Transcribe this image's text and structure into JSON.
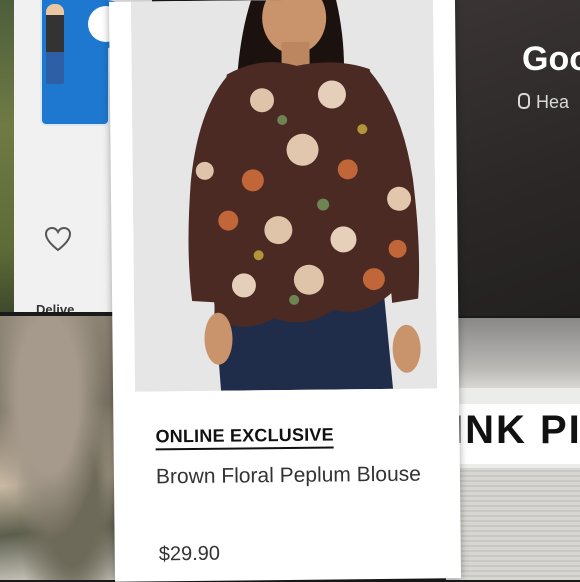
{
  "collage": {
    "tile_top_left": {
      "icon": "heart-outline-icon",
      "footer_text": "Delive"
    },
    "tile_top_right": {
      "title": "Goo",
      "subtitle": "Hea"
    },
    "tile_bottom_right": {
      "print_text": "INK PI"
    }
  },
  "product": {
    "badge": "ONLINE EXCLUSIVE",
    "name": "Brown Floral Peplum Blouse",
    "price": "$29.90",
    "colors": {
      "blouse": "#4b2a24",
      "denim": "#1f2c4a",
      "background": "#e6e6e6"
    }
  }
}
